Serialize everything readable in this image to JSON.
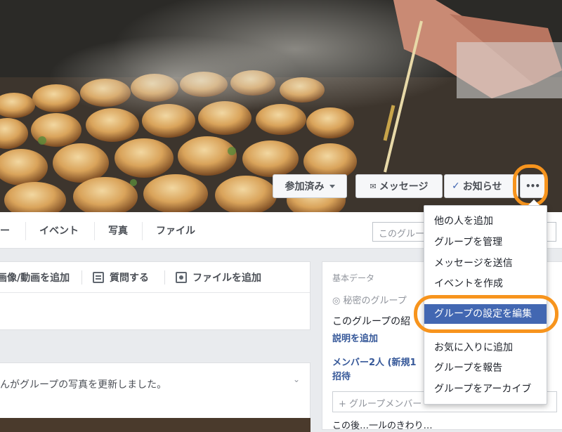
{
  "cover": {
    "buttons": {
      "joined": "参加済み",
      "message": "メッセージ",
      "notifications": "お知らせ",
      "more": "•••"
    }
  },
  "tabs": {
    "partial": "ー",
    "events": "イベント",
    "photos": "写真",
    "files": "ファイル"
  },
  "search": {
    "placeholder": "このグルー"
  },
  "composer": {
    "add_photo_video": "画像/動画を追加",
    "ask_question": "質問する",
    "add_file": "ファイルを追加"
  },
  "feed": {
    "story_text": "んがグループの写真を更新しました。",
    "chevron": "⌄"
  },
  "about": {
    "header": "基本データ",
    "privacy": "秘密のグループ",
    "description": "このグループの紹",
    "add_description": "説明を追加",
    "members": "メンバー2人 (新規1",
    "invite": "招待",
    "add_member": "+ グループメンバー",
    "truncated": "この後…一ルのきわり…"
  },
  "menu": {
    "items": [
      "他の人を追加",
      "グループを管理",
      "メッセージを送信",
      "イベントを作成",
      "グループの設定を編集",
      "お気に入りに追加",
      "グループを報告",
      "グループをアーカイブ"
    ],
    "selected_index": 4
  },
  "colors": {
    "highlight_ring": "#f7941d",
    "menu_selected": "#4267b2",
    "link": "#365899"
  }
}
